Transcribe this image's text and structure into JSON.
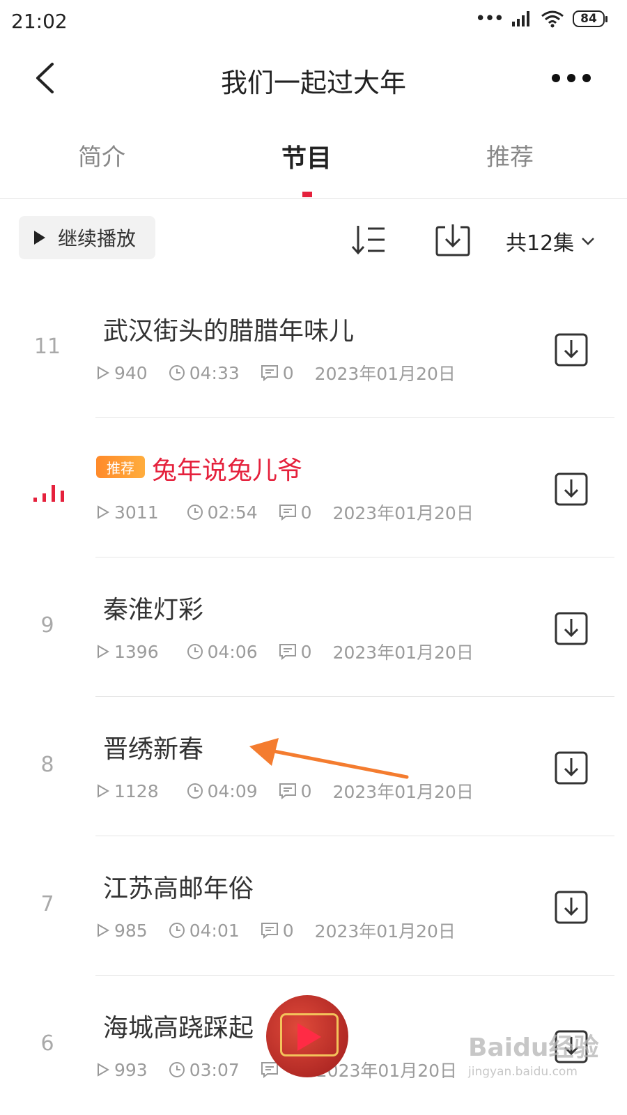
{
  "status_bar": {
    "time": "21:02",
    "battery": "84"
  },
  "header": {
    "title": "我们一起过大年"
  },
  "tabs": [
    {
      "label": "简介",
      "active": false
    },
    {
      "label": "节目",
      "active": true
    },
    {
      "label": "推荐",
      "active": false
    }
  ],
  "toolbar": {
    "continue_label": "继续播放",
    "episodes_label": "共12集"
  },
  "colors": {
    "accent": "#e5213c",
    "badge": "#ff9933",
    "annotation_arrow": "#f47c2f"
  },
  "episodes": [
    {
      "num": "11",
      "title": "武汉街头的腊腊年味儿",
      "plays": "940",
      "duration": "04:33",
      "comments": "0",
      "date": "2023年01月20日",
      "playing": false
    },
    {
      "num": "",
      "badge": "推荐",
      "title": "兔年说兔儿爷",
      "plays": "3011",
      "duration": "02:54",
      "comments": "0",
      "date": "2023年01月20日",
      "playing": true
    },
    {
      "num": "9",
      "title": "秦淮灯彩",
      "plays": "1396",
      "duration": "04:06",
      "comments": "0",
      "date": "2023年01月20日",
      "playing": false
    },
    {
      "num": "8",
      "title": "晋绣新春",
      "plays": "1128",
      "duration": "04:09",
      "comments": "0",
      "date": "2023年01月20日",
      "playing": false
    },
    {
      "num": "7",
      "title": "江苏高邮年俗",
      "plays": "985",
      "duration": "04:01",
      "comments": "0",
      "date": "2023年01月20日",
      "playing": false
    },
    {
      "num": "6",
      "title": "海城高跷踩起",
      "plays": "993",
      "duration": "03:07",
      "comments": "",
      "date": "2023年01月20日",
      "playing": false
    }
  ],
  "watermark": {
    "brand": "Baidu经验",
    "url": "jingyan.baidu.com"
  }
}
